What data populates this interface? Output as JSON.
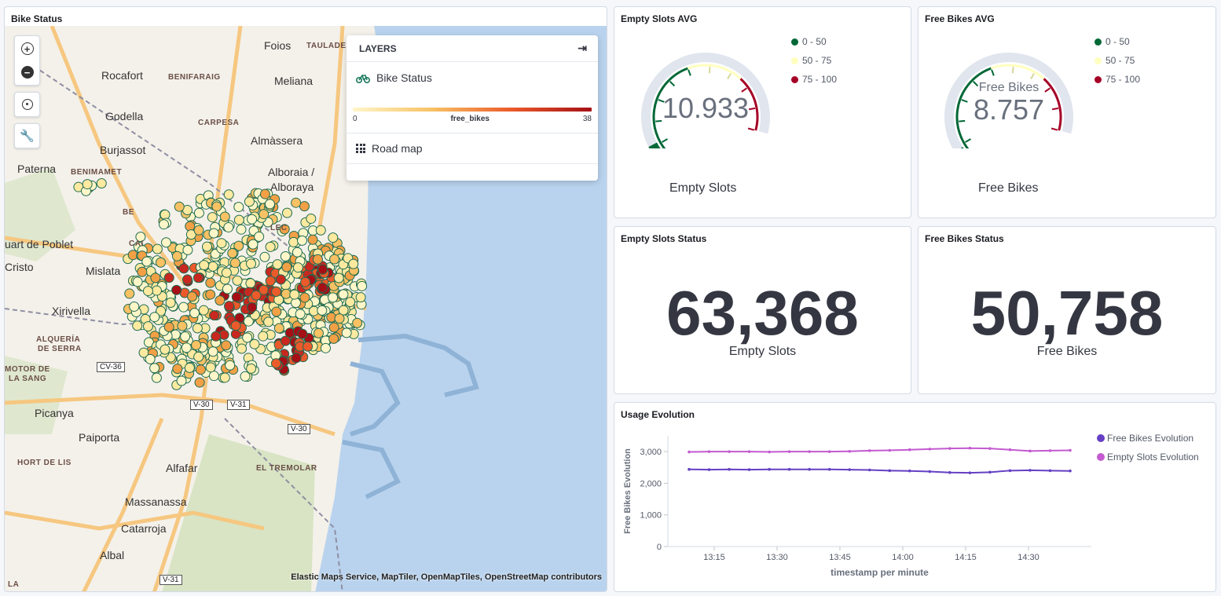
{
  "map_panel": {
    "title": "Bike Status",
    "layers_title": "LAYERS",
    "layers": [
      {
        "name": "Bike Status",
        "icon": "bicycle-icon"
      },
      {
        "name": "Road map",
        "icon": "grid-icon"
      }
    ],
    "gradient": {
      "min": "0",
      "max": "38",
      "field": "free_bikes",
      "colors": [
        "#fef6c8",
        "#f8c164",
        "#ea5a2a",
        "#a50f15"
      ]
    },
    "attribution": "Elastic Maps Service, MapTiler, OpenMapTiles, OpenStreetMap contributors",
    "places": [
      "Foios",
      "TAULADE",
      "Rocafort",
      "BENIFARAIG",
      "Meliana",
      "Godella",
      "CARPESA",
      "Almàssera",
      "Burjassot",
      "Paterna",
      "BENIMAMET",
      "Alboraia /",
      "Alboraya",
      "BE",
      "CAI",
      "LEC",
      "uart de Poblet",
      "Cristo",
      "Mislata",
      "Xirivella",
      "ALQUERÍA",
      "DE SERRA",
      "MOTOR DE",
      "LA SANG",
      "Picanya",
      "Paiporta",
      "HORT DE LIS",
      "EL TREMOLAR",
      "Alfafar",
      "Massanassa",
      "Catarroja",
      "Albal",
      "LA"
    ],
    "roads": [
      "CV-36",
      "V-30",
      "V-31",
      "V-30",
      "V-31"
    ]
  },
  "empty_avg": {
    "title": "Empty Slots AVG",
    "value": "10.933",
    "label": "Empty Slots",
    "fill_percent": 10.933,
    "legend": [
      {
        "label": "0 - 50",
        "color": "#006837"
      },
      {
        "label": "50 - 75",
        "color": "#ffffbf"
      },
      {
        "label": "75 - 100",
        "color": "#a50026"
      }
    ]
  },
  "free_avg": {
    "title": "Free Bikes AVG",
    "value": "8.757",
    "inner_label": "Free Bikes",
    "label": "Free Bikes",
    "fill_percent": 8.757,
    "legend": [
      {
        "label": "0 - 50",
        "color": "#006837"
      },
      {
        "label": "50 - 75",
        "color": "#ffffbf"
      },
      {
        "label": "75 - 100",
        "color": "#a50026"
      }
    ]
  },
  "empty_status": {
    "title": "Empty Slots Status",
    "value": "63,368",
    "label": "Empty Slots"
  },
  "free_status": {
    "title": "Free Bikes Status",
    "value": "50,758",
    "label": "Free Bikes"
  },
  "usage": {
    "title": "Usage Evolution",
    "chart_data": {
      "type": "line",
      "title": "Usage Evolution",
      "xlabel": "timestamp per minute",
      "ylabel": "Free Bikes Evolution",
      "ylim": [
        0,
        3500
      ],
      "yticks": [
        0,
        1000,
        2000,
        3000
      ],
      "ytick_labels": [
        "0",
        "1,000",
        "2,000",
        "3,000"
      ],
      "xtick_labels": [
        "13:15",
        "13:30",
        "13:45",
        "14:00",
        "14:15",
        "14:30"
      ],
      "legend_position": "top-right",
      "x_start_label": "13:15",
      "series": [
        {
          "name": "Free Bikes Evolution",
          "color": "#6540c4",
          "values": [
            2440,
            2430,
            2440,
            2430,
            2440,
            2440,
            2440,
            2440,
            2430,
            2420,
            2400,
            2390,
            2370,
            2340,
            2330,
            2350,
            2400,
            2410,
            2400,
            2390
          ]
        },
        {
          "name": "Empty Slots Evolution",
          "color": "#c35ad1",
          "values": [
            2990,
            3000,
            3000,
            3000,
            2990,
            3000,
            3000,
            3000,
            3010,
            3030,
            3040,
            3060,
            3080,
            3100,
            3110,
            3100,
            3060,
            3020,
            3030,
            3040
          ]
        }
      ]
    }
  }
}
